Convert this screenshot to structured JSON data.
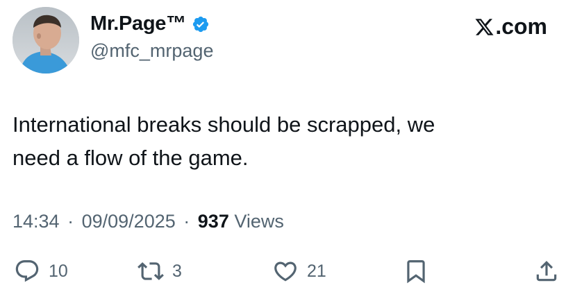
{
  "author": {
    "display_name": "Mr.Page™",
    "handle": "@mfc_mrpage",
    "avatar_icon": "profile-photo",
    "verified_icon": "verified-badge-icon",
    "verified_color": "#1d9bf0"
  },
  "brand": {
    "label": ".com",
    "logo_icon": "x-logo-icon"
  },
  "tweet": {
    "text": "International breaks should be scrapped, we\nneed a flow of the game."
  },
  "meta": {
    "time": "14:34",
    "separator": "·",
    "date": "09/09/2025",
    "views_count": "937",
    "views_label": "Views"
  },
  "actions": {
    "reply_count": "10",
    "repost_count": "3",
    "like_count": "21",
    "icons": [
      "reply-icon",
      "repost-icon",
      "like-icon",
      "bookmark-icon",
      "share-icon"
    ]
  },
  "colors": {
    "text_primary": "#0f1419",
    "text_secondary": "#536471",
    "accent": "#1d9bf0"
  }
}
